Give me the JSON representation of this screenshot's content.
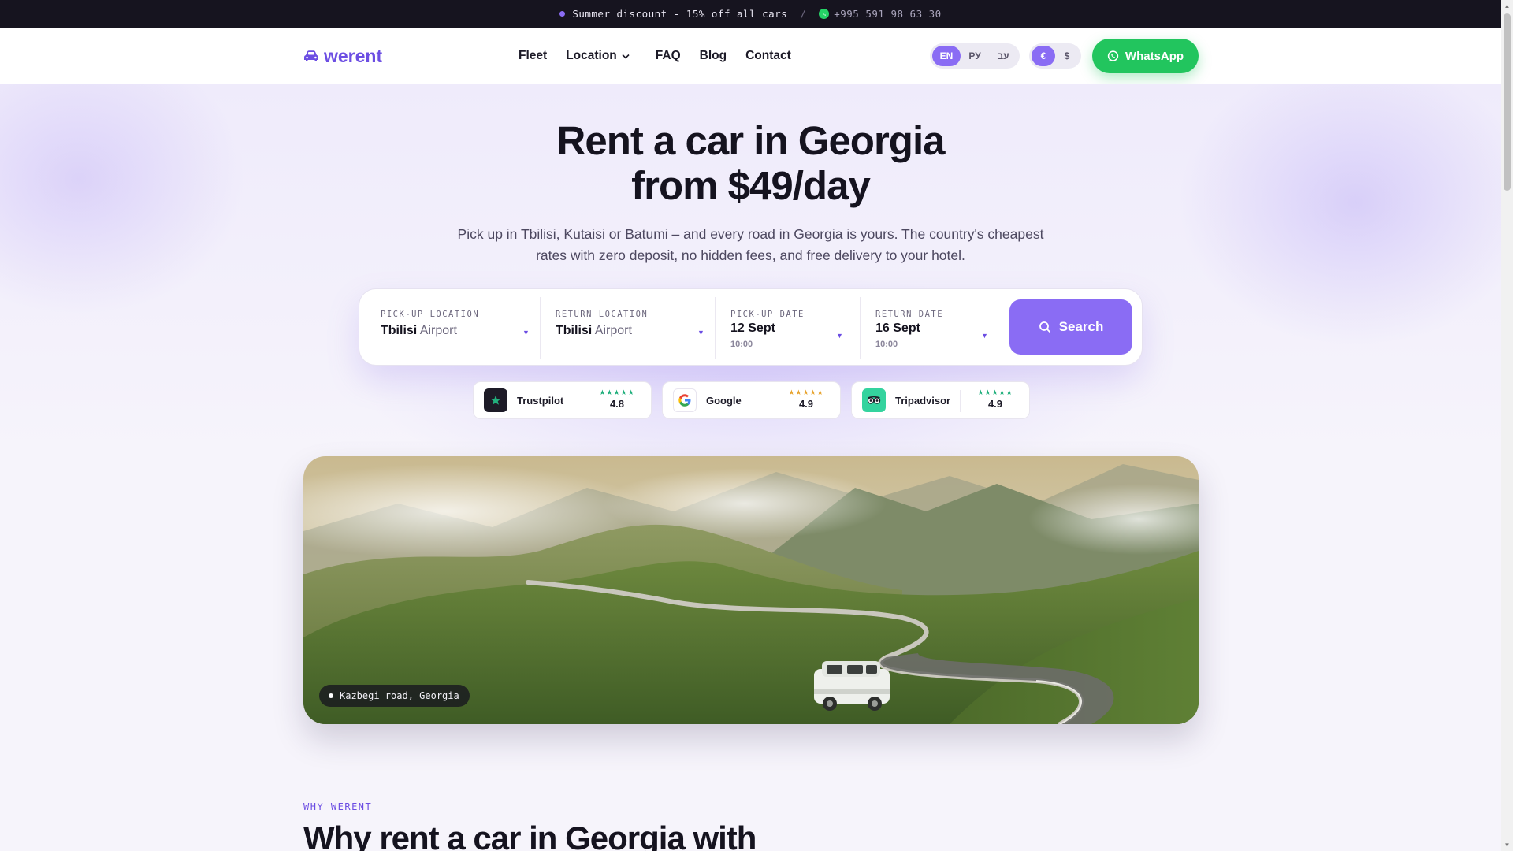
{
  "topbar": {
    "promo": "Summer discount - 15% off all cars",
    "separator": "/",
    "phone": "+995 591 98 63 30"
  },
  "header": {
    "logo": "werent",
    "nav": {
      "fleet": "Fleet",
      "location": "Location",
      "faq": "FAQ",
      "blog": "Blog",
      "contact": "Contact"
    },
    "languages": [
      "EN",
      "РУ",
      "עב"
    ],
    "active_language": "EN",
    "currencies": [
      "€",
      "$"
    ],
    "active_currency": "€",
    "whatsapp_label": "WhatsApp"
  },
  "hero": {
    "title_line1": "Rent a car in Georgia",
    "title_line2": "from $49/day",
    "subtitle": "Pick up in Tbilisi, Kutaisi or Batumi – and every road in Georgia is yours. The country's cheapest rates with zero deposit, no hidden fees, and free delivery to your hotel."
  },
  "search": {
    "pickup_location": {
      "label": "PICK-UP LOCATION",
      "city": "Tbilisi",
      "place": "Airport"
    },
    "return_location": {
      "label": "RETURN LOCATION",
      "city": "Tbilisi",
      "place": "Airport"
    },
    "pickup_date": {
      "label": "PICK-UP DATE",
      "date": "12 Sept",
      "time": "10:00"
    },
    "return_date": {
      "label": "RETURN DATE",
      "date": "16 Sept",
      "time": "10:00"
    },
    "button_label": "Search"
  },
  "ratings": [
    {
      "name": "Trustpilot",
      "stars": "★★★★★",
      "score": "4.8",
      "color": "#22b07d"
    },
    {
      "name": "Google",
      "stars": "★★★★★",
      "score": "4.9",
      "color": "#e8a531"
    },
    {
      "name": "Tripadvisor",
      "stars": "★★★★★",
      "score": "4.9",
      "color": "#22b07d"
    }
  ],
  "photo": {
    "caption": "Kazbegi road, Georgia"
  },
  "why": {
    "eyebrow": "WHY WERENT",
    "title": "Why rent a car in Georgia with"
  },
  "colors": {
    "accent": "#8a6cf4",
    "brand": "#6c4ee3",
    "whatsapp": "#22c55e",
    "dark": "#16141f"
  }
}
